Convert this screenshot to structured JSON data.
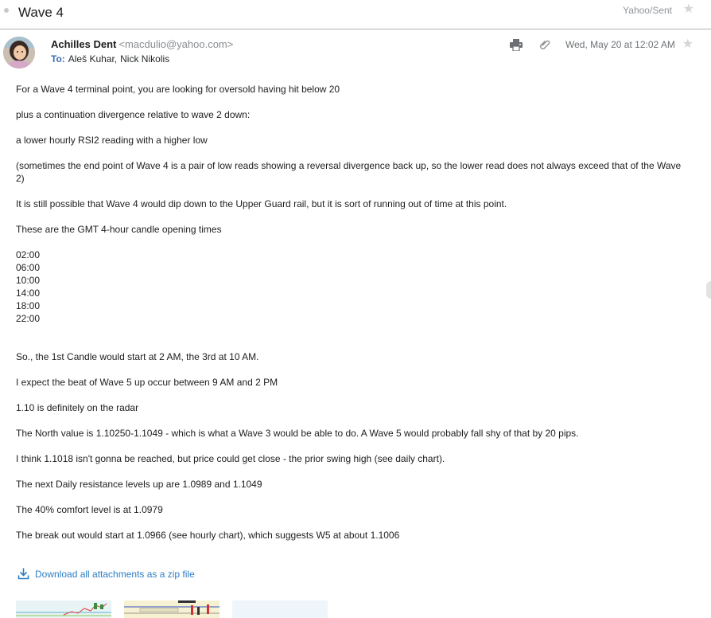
{
  "header": {
    "subject": "Wave 4",
    "folder": "Yahoo/Sent"
  },
  "message": {
    "sender_name": "Achilles Dent",
    "sender_email": "<macdulio@yahoo.com>",
    "to_label": "To:",
    "recipients": [
      "Aleš Kuhar,",
      "Nick Nikolis"
    ],
    "date": "Wed, May 20 at 12:02 AM"
  },
  "body": {
    "p1": "For a Wave 4 terminal point, you are looking for oversold having hit below 20",
    "p2": "plus a continuation divergence relative to wave 2 down:",
    "p3": "a lower hourly RSI2 reading with a higher low",
    "p4": "(sometimes the end point of Wave 4 is a pair of low reads showing a reversal divergence back up, so the lower read does not always exceed that of the Wave 2)",
    "p5": "It is still possible that Wave 4 would dip down to the Upper Guard rail, but it is sort of running out of time at this point.",
    "p6": "These are the GMT 4-hour candle opening times",
    "times": [
      "02:00",
      "06:00",
      "10:00",
      "14:00",
      "18:00",
      "22:00"
    ],
    "p7": "So., the 1st Candle would start at 2 AM, the 3rd at 10 AM.",
    "p8": "I expect the beat of Wave 5 up occur between 9 AM and 2 PM",
    "p9": "1.10 is definitely on the radar",
    "p10": "The North value is 1.10250-1.1049 - which is what a Wave 3 would be able to do. A Wave 5 would probably fall shy of that by 20 pips.",
    "p11": "I think 1.1018 isn't gonna be reached, but price could get close - the prior swing high (see daily chart).",
    "p12": "The next Daily resistance levels up are 1.0989 and 1.1049",
    "p13": "The 40% comfort level is at 1.0979",
    "p14": "The break out would start at 1.0966 (see hourly chart), which suggests W5 at about 1.1006"
  },
  "attachments": {
    "download_label": "Download all attachments as a zip file",
    "thumbnails": [
      "attachment-1",
      "attachment-2",
      "attachment-3"
    ]
  },
  "icons": {
    "star": "star-icon",
    "print": "print-icon",
    "attachment": "paperclip-icon",
    "download": "download-icon"
  },
  "colors": {
    "link": "#2d7ec5",
    "to_label": "#3a6cb5",
    "divider": "#b0b0b0"
  }
}
